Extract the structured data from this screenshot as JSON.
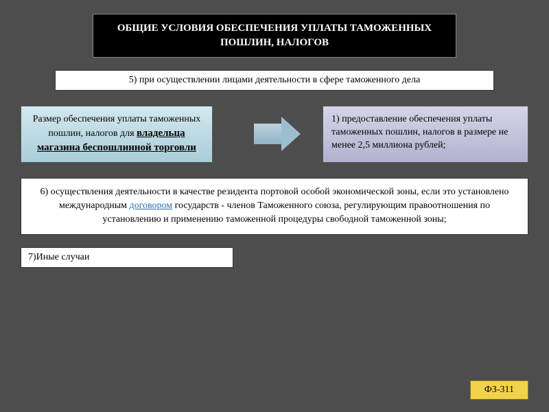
{
  "title": "ОБЩИЕ УСЛОВИЯ ОБЕСПЕЧЕНИЯ УПЛАТЫ ТАМОЖЕННЫХ ПОШЛИН, НАЛОГОВ",
  "item5": "5) при осуществлении лицами деятельности в сфере таможенного дела",
  "left_card": {
    "line1": "Размер обеспечения уплаты таможенных пошлин, налогов для ",
    "underline": "владельца магазина беспошлинной торговли"
  },
  "right_card": "1) предоставление обеспечения уплаты таможенных пошлин, налогов в размере не менее 2,5 миллиона рублей;",
  "item6_pre": "6) осуществления деятельности в качестве резидента портовой особой экономической зоны, если это установлено  международным ",
  "item6_link": "договором",
  "item6_post": " государств - членов Таможенного союза, регулирующим правоотношения по установлению и применению таможенной процедуры свободной таможенной зоны;",
  "item7": "7)Иные случаи",
  "reference": "ФЗ-311"
}
